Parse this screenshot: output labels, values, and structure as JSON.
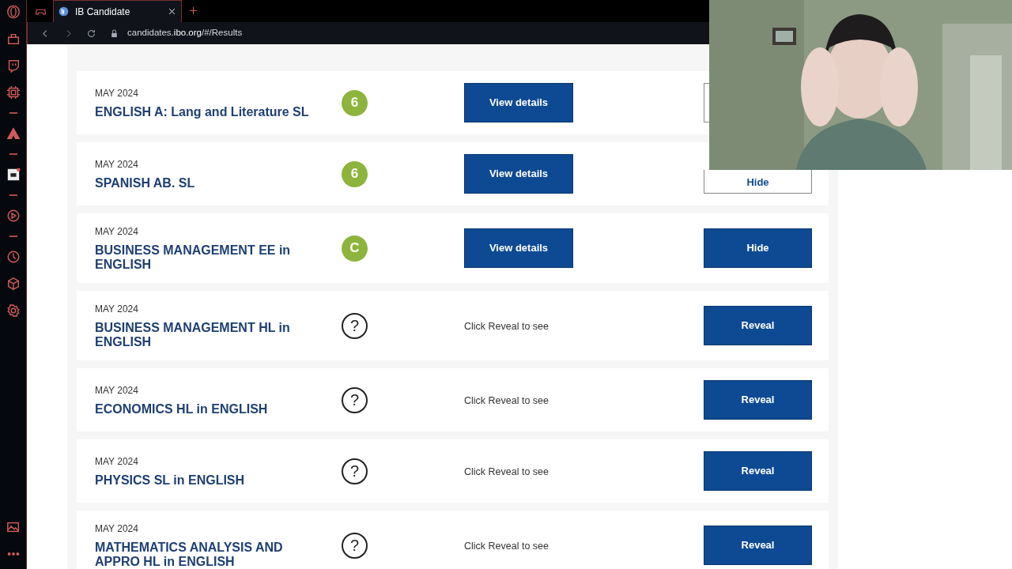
{
  "browser": {
    "tab": {
      "title": "IB Candidate",
      "selected": true
    },
    "url": "candidates.**ibo.org**/#/Results"
  },
  "results": [
    {
      "session": "MAY 2024",
      "subject": "ENGLISH A: Lang and Literature SL",
      "grade": "6",
      "revealed": true,
      "details": "View details",
      "action": {
        "kind": "outline"
      }
    },
    {
      "session": "MAY 2024",
      "subject": "SPANISH AB. SL",
      "grade": "6",
      "revealed": true,
      "details": "View details",
      "action": {
        "kind": "outline",
        "label": "Hide"
      }
    },
    {
      "session": "MAY 2024",
      "subject": "BUSINESS MANAGEMENT EE in ENGLISH",
      "grade": "C",
      "revealed": true,
      "details": "View details",
      "action": {
        "kind": "filled",
        "label": "Hide"
      }
    },
    {
      "session": "MAY 2024",
      "subject": "BUSINESS MANAGEMENT HL in ENGLISH",
      "grade": "?",
      "revealed": false,
      "details": "Click Reveal to see",
      "action": {
        "kind": "filled",
        "label": "Reveal"
      }
    },
    {
      "session": "MAY 2024",
      "subject": "ECONOMICS HL in ENGLISH",
      "grade": "?",
      "revealed": false,
      "details": "Click Reveal to see",
      "action": {
        "kind": "filled",
        "label": "Reveal"
      }
    },
    {
      "session": "MAY 2024",
      "subject": "PHYSICS SL in ENGLISH",
      "grade": "?",
      "revealed": false,
      "details": "Click Reveal to see",
      "action": {
        "kind": "filled",
        "label": "Reveal"
      }
    },
    {
      "session": "MAY 2024",
      "subject": "MATHEMATICS ANALYSIS AND APPRO HL in ENGLISH",
      "grade": "?",
      "revealed": false,
      "details": "Click Reveal to see",
      "action": {
        "kind": "filled",
        "label": "Reveal"
      }
    }
  ]
}
